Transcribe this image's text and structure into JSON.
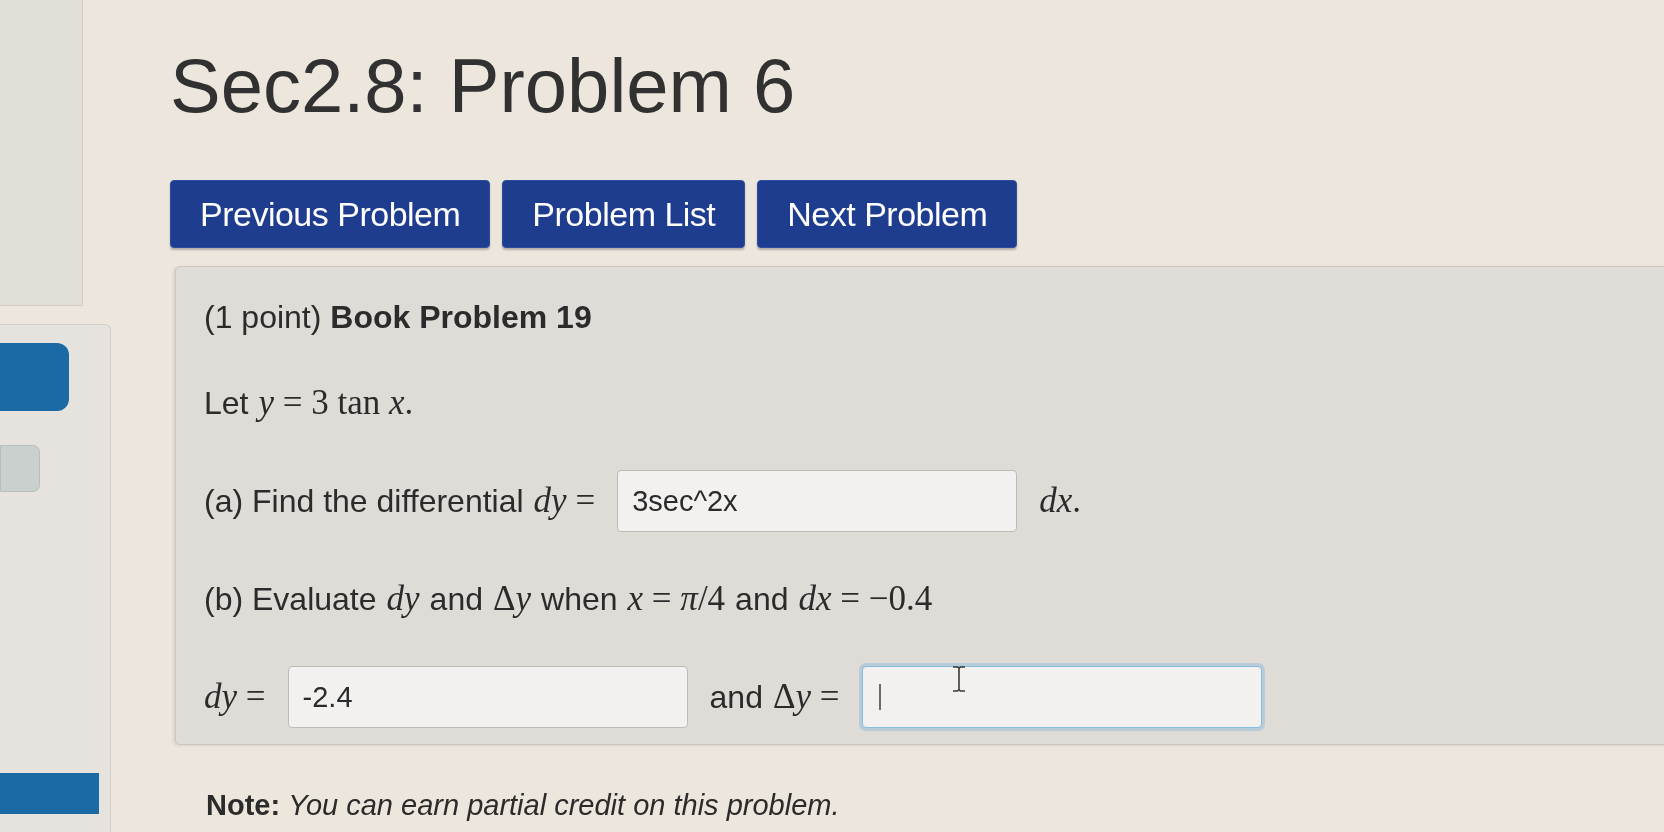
{
  "title": "Sec2.8: Problem 6",
  "nav_buttons": [
    "Previous Problem",
    "Problem List",
    "Next Problem"
  ],
  "problem": {
    "lines": [
      {
        "parts": [
          {
            "kind": "text",
            "text": "(1 point) **Book Problem 19**"
          }
        ]
      },
      {
        "parts": [
          {
            "kind": "text",
            "text": "Let"
          },
          {
            "kind": "math",
            "text": "*y* = 3 tan *x*."
          }
        ]
      },
      {
        "parts": [
          {
            "kind": "text",
            "text": "(a) Find the differential"
          },
          {
            "kind": "math",
            "text": "*dy* ="
          },
          {
            "kind": "input",
            "value": "3sec^2x",
            "focused": false
          },
          {
            "kind": "math",
            "text": "*dx*."
          }
        ]
      },
      {
        "parts": [
          {
            "kind": "text",
            "text": "(b) Evaluate"
          },
          {
            "kind": "math",
            "text": "*dy*"
          },
          {
            "kind": "text",
            "text": "and"
          },
          {
            "kind": "symbol",
            "text": "Δ"
          },
          {
            "kind": "math",
            "text": "*y*"
          },
          {
            "kind": "text",
            "text": "when"
          },
          {
            "kind": "math",
            "text": "*x* = *π*/4"
          },
          {
            "kind": "text",
            "text": "and"
          },
          {
            "kind": "math",
            "text": "*dx* = −0.4"
          }
        ]
      },
      {
        "parts": [
          {
            "kind": "math",
            "text": "*dy* ="
          },
          {
            "kind": "input",
            "value": "-2.4",
            "focused": false
          },
          {
            "kind": "text",
            "text": "and"
          },
          {
            "kind": "symbol",
            "text": "Δ"
          },
          {
            "kind": "math",
            "text": "*y* ="
          },
          {
            "kind": "input",
            "focused": true
          }
        ]
      }
    ]
  },
  "note": "**Note:** *You can earn partial credit on this problem.*"
}
